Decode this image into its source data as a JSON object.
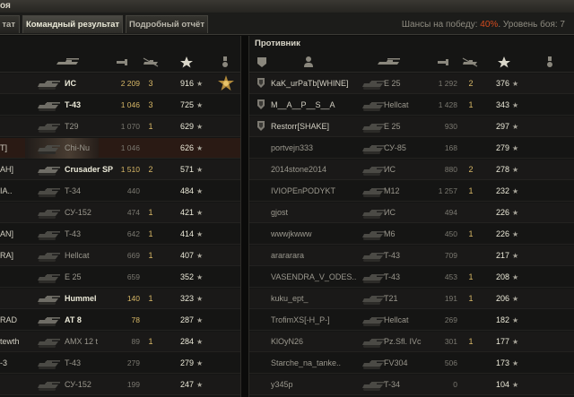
{
  "window": {
    "title": "оя"
  },
  "tabs": [
    {
      "label": "тат",
      "active": false
    },
    {
      "label": "Командный результат",
      "active": true
    },
    {
      "label": "Подробный отчёт",
      "active": false
    }
  ],
  "chance": {
    "prefix": "Шансы на победу: ",
    "percent": "40%",
    "suffix": ". Уровень боя: 7"
  },
  "right_team": {
    "title": "Противник"
  },
  "column_icons": [
    "platoon-icon",
    "player-icon",
    "tank-icon",
    "damage-icon",
    "kills-icon",
    "experience-star-icon",
    "medal-icon"
  ],
  "left_rows": [
    {
      "player": "",
      "tank": "ИС",
      "damage": "2 209",
      "kills": "3",
      "xp": "916",
      "medal": true,
      "bright": true
    },
    {
      "player": "",
      "tank": "T-43",
      "damage": "1 046",
      "kills": "3",
      "xp": "725",
      "bright": true
    },
    {
      "player": "",
      "tank": "T29",
      "damage": "1 070",
      "kills": "1",
      "xp": "629"
    },
    {
      "player": "T]",
      "tank": "Chi-Nu",
      "damage": "1 046",
      "kills": "",
      "xp": "626",
      "hl": true
    },
    {
      "player": "AH]",
      "tank": "Crusader SP",
      "damage": "1 510",
      "kills": "2",
      "xp": "571",
      "bright": true
    },
    {
      "player": "IA..",
      "tank": "T-34",
      "damage": "440",
      "kills": "",
      "xp": "484"
    },
    {
      "player": "",
      "tank": "СУ-152",
      "damage": "474",
      "kills": "1",
      "xp": "421"
    },
    {
      "player": "AN]",
      "tank": "T-43",
      "damage": "642",
      "kills": "1",
      "xp": "414"
    },
    {
      "player": "RA]",
      "tank": "Hellcat",
      "damage": "669",
      "kills": "1",
      "xp": "407"
    },
    {
      "player": "",
      "tank": "E 25",
      "damage": "659",
      "kills": "",
      "xp": "352"
    },
    {
      "player": "",
      "tank": "Hummel",
      "damage": "140",
      "kills": "1",
      "xp": "323",
      "bright": true
    },
    {
      "player": "RAD",
      "tank": "AT 8",
      "damage": "78",
      "kills": "",
      "xp": "287",
      "bright": true
    },
    {
      "player": "tewth",
      "tank": "AMX 12 t",
      "damage": "89",
      "kills": "1",
      "xp": "284"
    },
    {
      "player": "-3",
      "tank": "T-43",
      "damage": "279",
      "kills": "",
      "xp": "279"
    },
    {
      "player": "",
      "tank": "СУ-152",
      "damage": "199",
      "kills": "",
      "xp": "247"
    }
  ],
  "right_rows": [
    {
      "platoon": true,
      "player": "KaK_urPaTb[WHINE]",
      "tank": "E 25",
      "damage": "1 292",
      "kills": "2",
      "xp": "376"
    },
    {
      "platoon": true,
      "player": "M__A__P__S__A",
      "tank": "Hellcat",
      "damage": "1 428",
      "kills": "1",
      "xp": "343"
    },
    {
      "platoon": true,
      "player": "Restorr[SHAKE]",
      "tank": "E 25",
      "damage": "930",
      "kills": "",
      "xp": "297"
    },
    {
      "player": "portvejn333",
      "tank": "СУ-85",
      "damage": "168",
      "kills": "",
      "xp": "279"
    },
    {
      "player": "2014stone2014",
      "tank": "ИС",
      "damage": "880",
      "kills": "2",
      "xp": "278"
    },
    {
      "player": "IVIOPEnPODYKT",
      "tank": "M12",
      "damage": "1 257",
      "kills": "1",
      "xp": "232"
    },
    {
      "player": "gjost",
      "tank": "ИС",
      "damage": "494",
      "kills": "",
      "xp": "226"
    },
    {
      "player": "wwwjkwww",
      "tank": "M6",
      "damage": "450",
      "kills": "1",
      "xp": "226"
    },
    {
      "player": "arararara",
      "tank": "T-43",
      "damage": "709",
      "kills": "",
      "xp": "217"
    },
    {
      "player": "VASENDRA_V_ODES..",
      "tank": "T-43",
      "damage": "453",
      "kills": "1",
      "xp": "208"
    },
    {
      "player": "kuku_ept_",
      "tank": "T21",
      "damage": "191",
      "kills": "1",
      "xp": "206"
    },
    {
      "player": "TrofimXS[-H_P-]",
      "tank": "Hellcat",
      "damage": "269",
      "kills": "",
      "xp": "182"
    },
    {
      "player": "KlOyN26",
      "tank": "Pz.Sfl. IVc",
      "damage": "301",
      "kills": "1",
      "xp": "177"
    },
    {
      "player": "Starche_na_tanke..",
      "tank": "FV304",
      "damage": "506",
      "kills": "",
      "xp": "173"
    },
    {
      "player": "y345p",
      "tank": "T-34",
      "damage": "0",
      "kills": "",
      "xp": "104"
    }
  ],
  "star_glyph": "★",
  "colors": {
    "accent": "#d44b1f",
    "gold": "#d7b766"
  }
}
